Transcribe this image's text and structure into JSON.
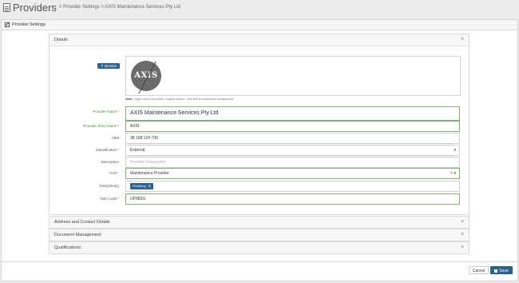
{
  "header": {
    "title": "Providers",
    "breadcrumb": "> Provider Settings > AXIS Maintenance Services Pty Ltd"
  },
  "panel": {
    "title": "Provider Settings"
  },
  "details": {
    "title": "Details",
    "logo": {
      "label": "Logo",
      "browse_label": "Browse",
      "logo_text": "AXIS",
      "note_bold": "Note:",
      "note_text": " Logos work best when roughly square, and with a transparent background."
    },
    "fields": {
      "provider_name": {
        "label": "Provider Name",
        "value": "AXIS Maintenance Services Pty Ltd"
      },
      "short_name": {
        "label": "Provider Short Name",
        "value": "AXIS"
      },
      "abn": {
        "label": "ABN",
        "value": "38 168 124 730"
      },
      "classification": {
        "label": "Classification",
        "value": "External"
      },
      "description": {
        "label": "Description",
        "placeholder": "Provider Description"
      },
      "field": {
        "label": "Field",
        "value": "Maintenance Provider"
      },
      "disciplines": {
        "label": "Discipline(s)",
        "chip": "Plumbing"
      },
      "jwa_code": {
        "label": "JWA Code",
        "value": "OFM001"
      }
    }
  },
  "sections": [
    {
      "title": "Address and Contact Details"
    },
    {
      "title": "Document Management"
    },
    {
      "title": "Qualifications"
    }
  ],
  "footer": {
    "cancel_label": "Cancel",
    "save_label": "Save"
  },
  "colors": {
    "accent": "#2a6496",
    "required": "#cc3333",
    "valid_border": "#7fb36d"
  }
}
